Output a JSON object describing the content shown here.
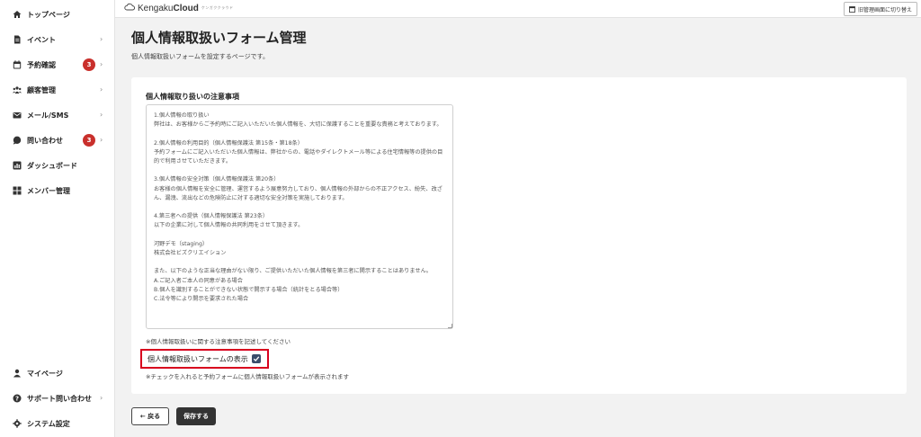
{
  "sidebar": {
    "items": [
      {
        "label": "トップページ",
        "icon": "home-icon"
      },
      {
        "label": "イベント",
        "icon": "document-icon",
        "chevron": "›"
      },
      {
        "label": "予約確認",
        "icon": "calendar-icon",
        "badge": "3",
        "chevron": "›"
      },
      {
        "label": "顧客管理",
        "icon": "users-icon",
        "chevron": "›"
      },
      {
        "label": "メール/SMS",
        "icon": "mail-icon",
        "chevron": "›"
      },
      {
        "label": "問い合わせ",
        "icon": "chat-icon",
        "badge": "3",
        "chevron": "›"
      },
      {
        "label": "ダッシュボード",
        "icon": "chart-icon"
      },
      {
        "label": "メンバー管理",
        "icon": "grid-icon"
      }
    ],
    "bottom_items": [
      {
        "label": "マイページ",
        "icon": "person-icon"
      },
      {
        "label": "サポート問い合わせ",
        "icon": "help-icon",
        "chevron": "›"
      },
      {
        "label": "システム設定",
        "icon": "gear-icon"
      }
    ]
  },
  "topbar": {
    "brand_prefix": "Kengaku",
    "brand_suffix": "Cloud",
    "brand_tagline": "ケンガククラウド",
    "switch_label": "旧管理画面に切り替え"
  },
  "page": {
    "title": "個人情報取扱いフォーム管理",
    "subtitle": "個人情報取扱いフォームを設定するページです。"
  },
  "form": {
    "notice_label": "個人情報取り扱いの注意事項",
    "notice_text": "1.個人情報の取り扱い\n弊社は、お客様からご予約時にご記入いただいた個人情報を、大切に保護することを重要な責務と考えております。\n\n2.個人情報の利用目的（個人情報保護法 第15条・第18条）\n予約フォームにご記入いただいた個人情報は、弊社からの、電話やダイレクトメール等による住宅情報等の提供の目的で利用させていただきます。\n\n3.個人情報の安全対策（個人情報保護法 第20条）\nお客様の個人情報を安全に管理、運営するよう展意努力しており、個人情報の外部からの不正アクセス、紛失、改ざん、漏洩、流出などの危険防止に対する適切な安全対策を実施しております。\n\n4.第三者への提供（個人情報保護法 第23条）\n以下の企業に対して個人情報の共同利用をさせて頂きます。\n\n河野デモ（staging）\n株式会社ビズクリエイション\n\nまた、以下のような正当な理由がない限り、ご提供いただいた個人情報を第三者に開示することはありません。\nA.ご記入者ご本人の同意がある場合\nB.個人を識別することができない状態で開示する場合（統計をとる場合等）\nC.法令等により開示を要求された場合",
    "notice_help": "※個人情報取扱いに関する注意事項を記述してください",
    "toggle_label": "個人情報取扱いフォームの表示",
    "toggle_checked": true,
    "toggle_help": "※チェックを入れると予約フォームに個人情報取扱いフォームが表示されます"
  },
  "actions": {
    "back_label": "← 戻る",
    "save_label": "保存する"
  },
  "colors": {
    "badge": "#c9302c",
    "highlight_border": "#d8001e",
    "checkbox": "#3a4d6b",
    "save_button": "#333333"
  }
}
